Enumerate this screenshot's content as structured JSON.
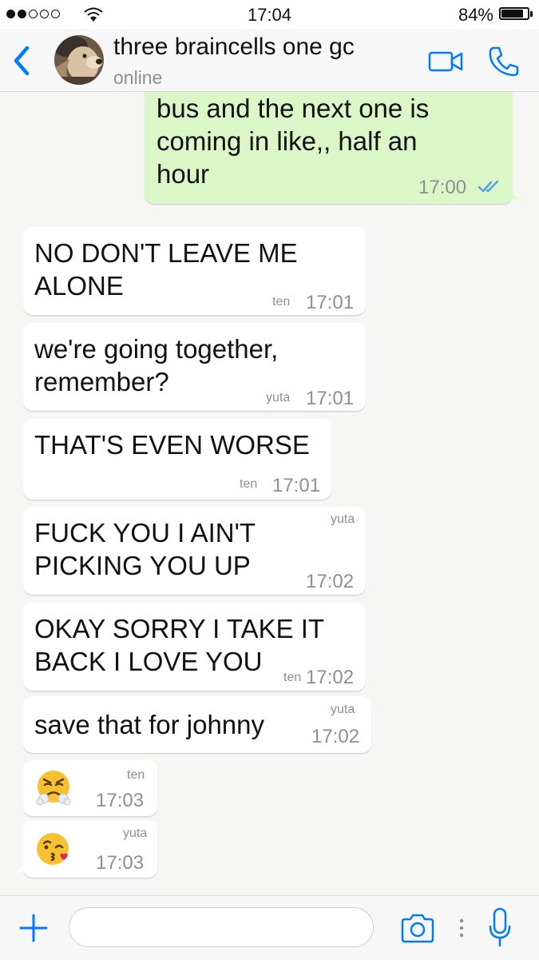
{
  "status_bar": {
    "time": "17:04",
    "battery_percent": "84%",
    "battery_level": 0.84,
    "signal_bars_filled": 2,
    "signal_bars_total": 5
  },
  "header": {
    "chat_name": "three braincells one gc",
    "status": "online",
    "accent_color": "#007aff"
  },
  "messages": [
    {
      "direction": "outgoing",
      "lines": [
        "bus and the next one is",
        "coming in like,, half an",
        "hour"
      ],
      "time": "17:00",
      "read": true
    },
    {
      "direction": "incoming",
      "lines": [
        "NO DON'T LEAVE ME",
        "ALONE"
      ],
      "sender": "ten",
      "time": "17:01"
    },
    {
      "direction": "incoming",
      "lines": [
        "we're going together,",
        "remember?"
      ],
      "sender": "yuta",
      "time": "17:01"
    },
    {
      "direction": "incoming",
      "lines": [
        "THAT'S EVEN WORSE"
      ],
      "sender": "ten",
      "time": "17:01"
    },
    {
      "direction": "incoming",
      "lines": [
        "FUCK YOU I AIN'T",
        "PICKING YOU UP"
      ],
      "sender": "yuta",
      "time": "17:02"
    },
    {
      "direction": "incoming",
      "lines": [
        "OKAY SORRY I TAKE IT",
        "BACK I LOVE YOU"
      ],
      "sender": "ten",
      "time": "17:02"
    },
    {
      "direction": "incoming",
      "lines": [
        "save that for johnny"
      ],
      "sender": "yuta",
      "time": "17:02"
    },
    {
      "direction": "incoming",
      "emoji": "face-with-steam-from-nose",
      "sender": "ten",
      "time": "17:03"
    },
    {
      "direction": "incoming",
      "emoji": "face-blowing-a-kiss",
      "sender": "yuta",
      "time": "17:03"
    }
  ],
  "input_bar": {
    "placeholder": "",
    "icons": [
      "plus-icon",
      "camera-icon",
      "more-dots-icon",
      "microphone-icon"
    ]
  },
  "colors": {
    "outgoing_bubble": "#dcf7c7",
    "incoming_bubble": "#ffffff",
    "chat_background": "#f6f6f4",
    "read_ticks": "#4fa3e6",
    "meta_text": "#8e8e93"
  }
}
